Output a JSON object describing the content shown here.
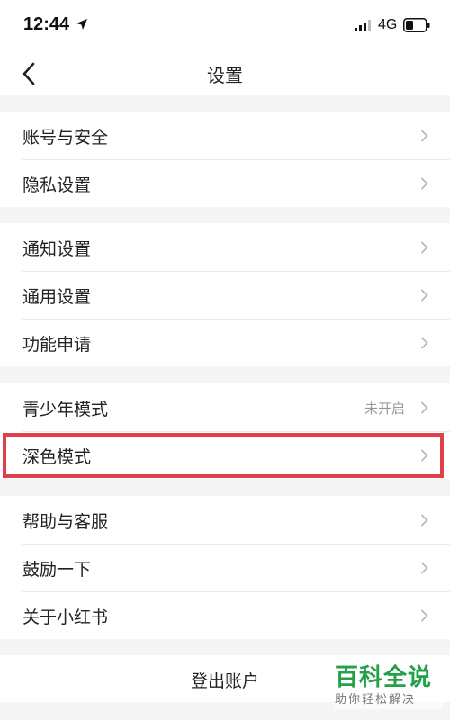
{
  "status_bar": {
    "time": "12:44",
    "network": "4G",
    "icons": [
      "location-arrow-icon",
      "signal-icon",
      "battery-icon"
    ]
  },
  "nav": {
    "title": "设置",
    "back_icon": "chevron-left-icon"
  },
  "groups": [
    {
      "items": [
        {
          "label": "账号与安全"
        },
        {
          "label": "隐私设置"
        }
      ]
    },
    {
      "items": [
        {
          "label": "通知设置"
        },
        {
          "label": "通用设置"
        },
        {
          "label": "功能申请"
        }
      ]
    },
    {
      "items": [
        {
          "label": "青少年模式",
          "value": "未开启"
        },
        {
          "label": "深色模式",
          "highlighted": true
        }
      ]
    },
    {
      "items": [
        {
          "label": "帮助与客服"
        },
        {
          "label": "鼓励一下"
        },
        {
          "label": "关于小红书"
        }
      ]
    }
  ],
  "logout": {
    "label": "登出账户"
  },
  "watermark": {
    "title": "百科全说",
    "subtitle": "助你轻松解决"
  },
  "colors": {
    "highlight": "#e0404c",
    "watermark": "#23a04a",
    "background": "#f5f5f5"
  }
}
